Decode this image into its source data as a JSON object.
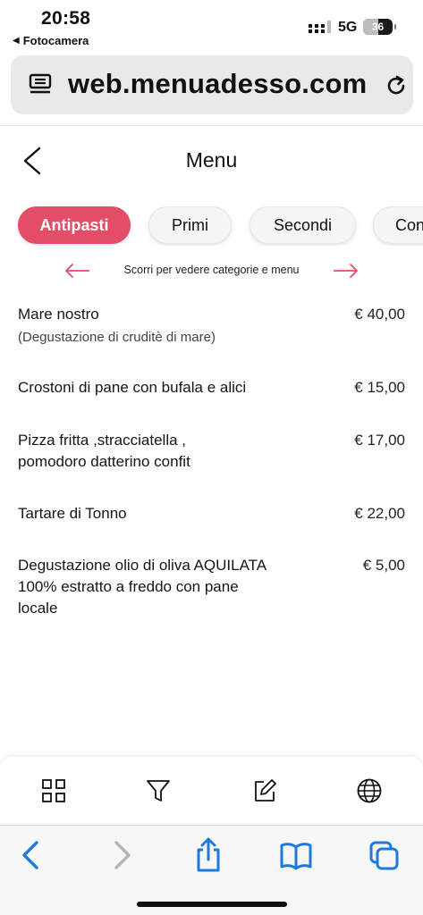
{
  "status_bar": {
    "time": "20:58",
    "back_app": "Fotocamera",
    "network": "5G",
    "battery": "36"
  },
  "browser": {
    "url": "web.menuadesso.com"
  },
  "header": {
    "title": "Menu"
  },
  "categories": {
    "tabs": [
      "Antipasti",
      "Primi",
      "Secondi",
      "Con"
    ],
    "active_index": 0,
    "scroll_hint": "Scorri per vedere categorie e menu"
  },
  "menu": {
    "items": [
      {
        "name": "Mare nostro",
        "description": "(Degustazione di cruditè di mare)",
        "price": "€ 40,00"
      },
      {
        "name": "Crostoni di pane con bufala e alici",
        "description": "",
        "price": "€ 15,00"
      },
      {
        "name": "Pizza fritta ,stracciatella , pomodoro datterino confit",
        "description": "",
        "price": "€ 17,00"
      },
      {
        "name": "Tartare di Tonno",
        "description": "",
        "price": "€ 22,00"
      },
      {
        "name": "Degustazione olio di oliva AQUILATA 100% estratto a freddo con pane locale",
        "description": "",
        "price": "€ 5,00"
      }
    ]
  },
  "colors": {
    "accent": "#e34d67",
    "safari_blue": "#1f7ae0"
  }
}
